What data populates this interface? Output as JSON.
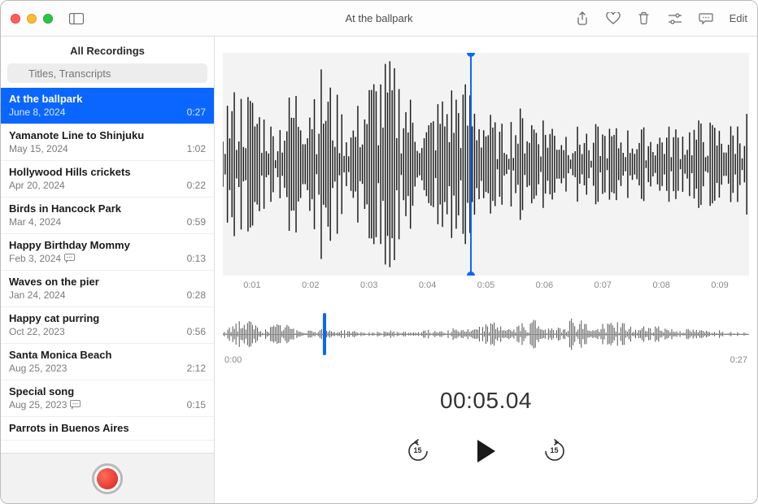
{
  "window_title": "At the ballpark",
  "toolbar": {
    "edit_label": "Edit"
  },
  "sidebar": {
    "header": "All Recordings",
    "search_placeholder": "Titles, Transcripts",
    "recordings": [
      {
        "title": "At the ballpark",
        "date": "June 8, 2024",
        "duration": "0:27",
        "selected": true,
        "transcript": false
      },
      {
        "title": "Yamanote Line to Shinjuku",
        "date": "May 15, 2024",
        "duration": "1:02",
        "selected": false,
        "transcript": false
      },
      {
        "title": "Hollywood Hills crickets",
        "date": "Apr 20, 2024",
        "duration": "0:22",
        "selected": false,
        "transcript": false
      },
      {
        "title": "Birds in Hancock Park",
        "date": "Mar 4, 2024",
        "duration": "0:59",
        "selected": false,
        "transcript": false
      },
      {
        "title": "Happy Birthday Mommy",
        "date": "Feb 3, 2024",
        "duration": "0:13",
        "selected": false,
        "transcript": true
      },
      {
        "title": "Waves on the pier",
        "date": "Jan 24, 2024",
        "duration": "0:28",
        "selected": false,
        "transcript": false
      },
      {
        "title": "Happy cat purring",
        "date": "Oct 22, 2023",
        "duration": "0:56",
        "selected": false,
        "transcript": false
      },
      {
        "title": "Santa Monica Beach",
        "date": "Aug 25, 2023",
        "duration": "2:12",
        "selected": false,
        "transcript": false
      },
      {
        "title": "Special song",
        "date": "Aug 25, 2023",
        "duration": "0:15",
        "selected": false,
        "transcript": true
      },
      {
        "title": "Parrots in Buenos Aires",
        "date": "",
        "duration": "",
        "selected": false,
        "transcript": false
      }
    ]
  },
  "player": {
    "ruler_ticks": [
      "0:01",
      "0:02",
      "0:03",
      "0:04",
      "0:05",
      "0:06",
      "0:07",
      "0:08",
      "0:09"
    ],
    "overview_start": "0:00",
    "overview_end": "0:27",
    "current_time": "00:05.04",
    "skip_seconds": "15",
    "playhead_main_pct": 47,
    "playhead_overview_pct": 19,
    "total_duration_sec": 27
  },
  "icons": {
    "sidebar_toggle": "sidebar-icon",
    "share": "share-icon",
    "favorite": "heart-icon",
    "trash": "trash-icon",
    "settings": "sliders-icon",
    "transcript": "speech-bubble-icon"
  }
}
